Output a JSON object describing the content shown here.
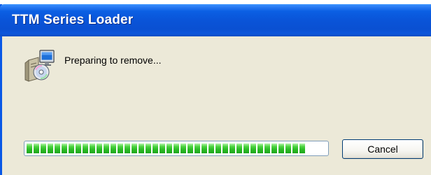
{
  "window": {
    "title": "TTM Series Loader"
  },
  "dialog": {
    "icon": "setup-installer-icon",
    "message": "Preparing to remove..."
  },
  "progress": {
    "value_percent": 93,
    "segment_color": "#2cbc26"
  },
  "buttons": {
    "cancel_label": "Cancel"
  },
  "colors": {
    "titlebar": "#0a54d8",
    "window_background": "#ece9d8"
  }
}
